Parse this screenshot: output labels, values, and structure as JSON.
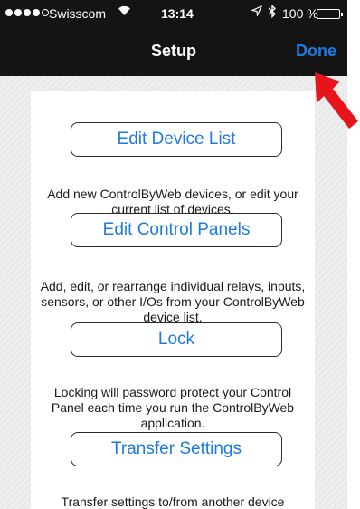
{
  "status_bar": {
    "carrier": "Swisscom",
    "time": "13:14",
    "battery": "100 %",
    "signal_dots_filled": 4,
    "signal_dots_total": 5,
    "icons": [
      "wifi-icon",
      "location-icon",
      "bluetooth-icon",
      "battery-icon"
    ]
  },
  "nav": {
    "title": "Setup",
    "done_label": "Done"
  },
  "menu": {
    "edit_devices": {
      "label": "Edit Device List",
      "description": "Add new ControlByWeb devices, or edit your current list of devices."
    },
    "edit_panels": {
      "label": "Edit Control Panels",
      "description": "Add, edit, or rearrange individual relays, inputs, sensors, or other I/Os from your ControlByWeb device list."
    },
    "lock": {
      "label": "Lock",
      "description": "Locking will password protect your Control Panel each time you run the ControlByWeb application."
    },
    "transfer": {
      "label": "Transfer Settings",
      "description": "Transfer settings to/from another device"
    }
  },
  "colors": {
    "accent": "#1f7ae0",
    "bar_background": "#141414",
    "arrow": "#e8141b"
  }
}
